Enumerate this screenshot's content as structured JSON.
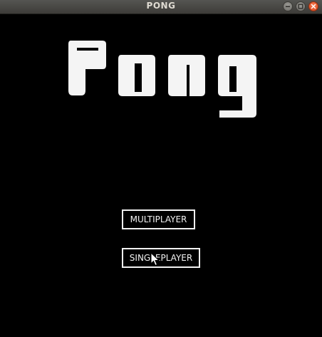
{
  "window": {
    "title": "PONG",
    "controls": [
      "minimize-icon",
      "maximize-icon",
      "close-icon"
    ]
  },
  "game": {
    "logo_text": "Pong"
  },
  "menu": {
    "multiplayer_label": "MULTIPLAYER",
    "singleplayer_label": "SINGLEPLAYER"
  },
  "colors": {
    "background": "#000000",
    "foreground": "#f2f2f2",
    "titlebar": "#3d3c38",
    "close_button": "#e0582b"
  }
}
